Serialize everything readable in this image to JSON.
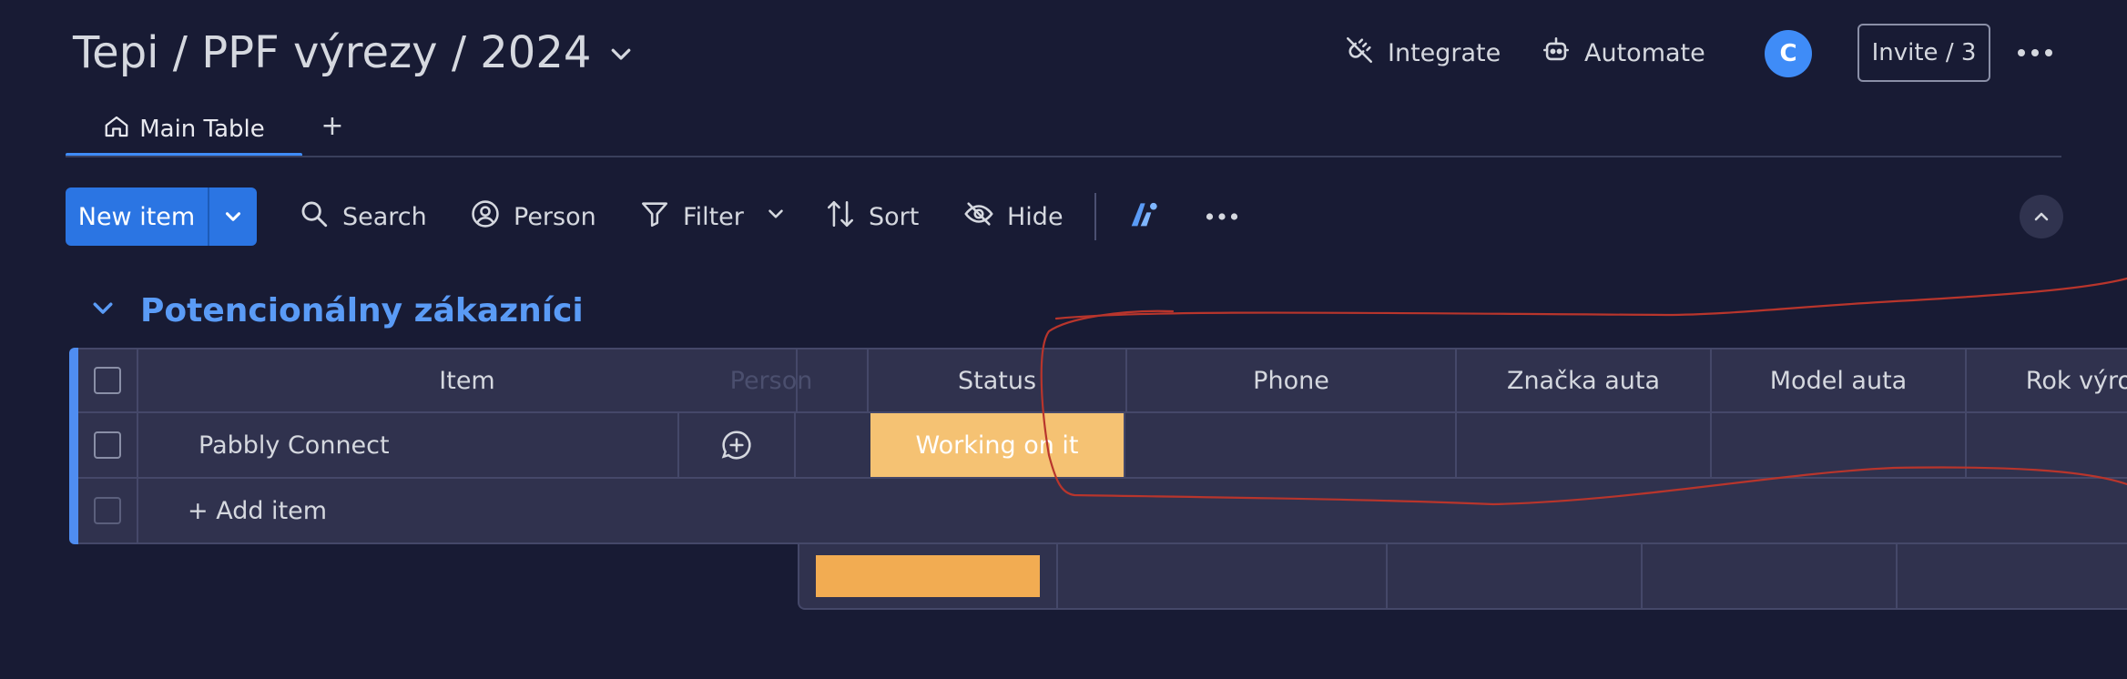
{
  "header": {
    "title": "Tepi / PPF výrezy / 2024",
    "integrate_label": "Integrate",
    "automate_label": "Automate",
    "avatar_initial": "C",
    "invite_label": "Invite / 3"
  },
  "tabs": {
    "main_label": "Main Table",
    "add_label": "+"
  },
  "toolbar": {
    "new_item_label": "New item",
    "search_label": "Search",
    "person_label": "Person",
    "filter_label": "Filter",
    "sort_label": "Sort",
    "hide_label": "Hide"
  },
  "group": {
    "title": "Potencionálny zákazníci",
    "color": "#5a9bf6",
    "columns": {
      "item": "Item",
      "person": "Person",
      "status": "Status",
      "phone": "Phone",
      "brand": "Značka auta",
      "model": "Model auta",
      "year": "Rok výroby"
    },
    "rows": [
      {
        "item": "Pabbly Connect",
        "status": "Working on it",
        "status_color": "#f5c273"
      }
    ],
    "add_item_label": "+ Add item"
  },
  "colors": {
    "background": "#181b34",
    "accent": "#2b75e3",
    "summary_status": "#f2ac52",
    "annotation": "#c0392b"
  }
}
